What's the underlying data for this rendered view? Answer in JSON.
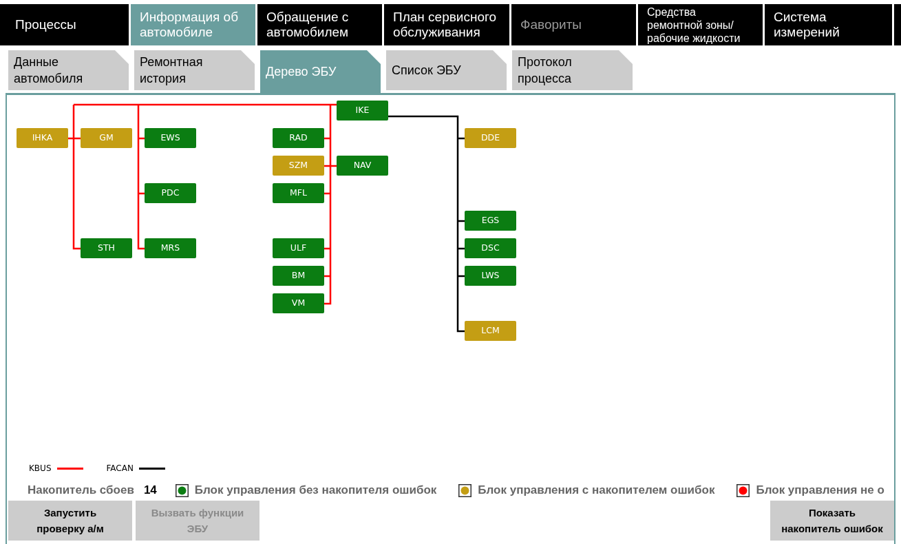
{
  "main_tabs": [
    {
      "label": "Процессы",
      "selected": false,
      "disabled": false
    },
    {
      "label": "Информация об автомобиле",
      "selected": true,
      "disabled": false
    },
    {
      "label": "Обращение с автомобилем",
      "selected": false,
      "disabled": false
    },
    {
      "label": "План сервисного обслуживания",
      "selected": false,
      "disabled": false
    },
    {
      "label": "Фавориты",
      "selected": false,
      "disabled": true
    },
    {
      "label": "Средства ремонтной зоны/ рабочие жидкости",
      "selected": false,
      "disabled": false
    },
    {
      "label": "Система измерений",
      "selected": false,
      "disabled": false
    }
  ],
  "sub_tabs": [
    {
      "label": "Данные автомобиля",
      "selected": false
    },
    {
      "label": "Ремонтная история",
      "selected": false
    },
    {
      "label": "Дерево ЭБУ",
      "selected": true
    },
    {
      "label": "Список ЭБУ",
      "selected": false
    },
    {
      "label": "Протокол процесса",
      "selected": false
    }
  ],
  "ecu_tree": {
    "units": [
      {
        "label": "IKE",
        "color": "#0b7d12"
      },
      {
        "label": "IHKA",
        "color": "#c49e14"
      },
      {
        "label": "GM",
        "color": "#c49e14"
      },
      {
        "label": "EWS",
        "color": "#0b7d12"
      },
      {
        "label": "RAD",
        "color": "#0b7d12"
      },
      {
        "label": "DDE",
        "color": "#c49e14"
      },
      {
        "label": "SZM",
        "color": "#c49e14"
      },
      {
        "label": "NAV",
        "color": "#0b7d12"
      },
      {
        "label": "PDC",
        "color": "#0b7d12"
      },
      {
        "label": "MFL",
        "color": "#0b7d12"
      },
      {
        "label": "EGS",
        "color": "#0b7d12"
      },
      {
        "label": "STH",
        "color": "#0b7d12"
      },
      {
        "label": "MRS",
        "color": "#0b7d12"
      },
      {
        "label": "ULF",
        "color": "#0b7d12"
      },
      {
        "label": "DSC",
        "color": "#0b7d12"
      },
      {
        "label": "BM",
        "color": "#0b7d12"
      },
      {
        "label": "LWS",
        "color": "#0b7d12"
      },
      {
        "label": "VM",
        "color": "#0b7d12"
      },
      {
        "label": "LCM",
        "color": "#c49e14"
      }
    ]
  },
  "bus_legend": [
    {
      "label": "KBUS",
      "color": "#ff0000"
    },
    {
      "label": "FACAN",
      "color": "#000000"
    }
  ],
  "fault_memory": {
    "label": "Накопитель сбоев",
    "count": "14"
  },
  "status_legend": [
    {
      "label": "Блок управления без накопителя ошибок",
      "color": "#0b7d12"
    },
    {
      "label": "Блок управления с накопителем ошибок",
      "color": "#c49e14"
    },
    {
      "label": "Блок управления не о",
      "color": "#ff0000"
    }
  ],
  "buttons": [
    {
      "label": "Запустить\nпроверку а/м",
      "disabled": false
    },
    {
      "label": "Вызвать функции\nЭБУ",
      "disabled": true
    },
    {
      "label": "Показать\nнакопитель ошибок",
      "disabled": false
    }
  ]
}
